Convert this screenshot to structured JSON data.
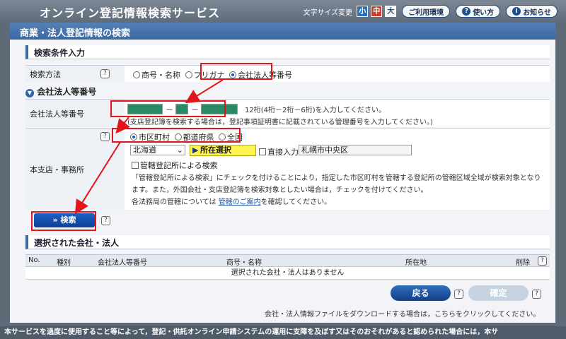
{
  "header": {
    "title": "オンライン登記情報検索サービス",
    "font_size_label": "文字サイズ変更",
    "font_sizes": [
      "小",
      "中",
      "大"
    ],
    "env": "ご利用環境",
    "howto": "使い方",
    "news": "お知らせ"
  },
  "page": {
    "title": "商業・法人登記情報の検索"
  },
  "conditions": {
    "title": "検索条件入力",
    "method_label": "検索方法",
    "methods": [
      "商号・名称",
      "フリガナ",
      "会社法人等番号"
    ],
    "number_section": "会社法人等番号",
    "number_label": "会社法人等番号",
    "number_hint": "12桁(4桁－2桁－6桁)を入力してください。",
    "number_hint2": "(支店登記簿を検索する場合は，登記事項証明書に記載されている管理番号を入力してください。)",
    "office_label": "本支店・事務所",
    "regions": [
      "市区町村",
      "都道府県",
      "全国"
    ],
    "prefecture": "北海道",
    "locate": "所在選択",
    "direct_label": "直接入力",
    "city": "札幌市中央区",
    "jurisdiction": "管轄登記所による検索",
    "desc1": "「管轄登記所による検索」にチェックを付けることにより，指定した市区町村を管轄する登記所の管轄区域全域が検索対象となり",
    "desc2": "ます。また，外国会社・支店登記簿を検索対象としたい場合は，チェックを付けてください。",
    "desc3": "各法務局の管轄については",
    "desc_link": "管轄のご案内",
    "desc4": "を確認してください。",
    "search": "検索"
  },
  "selected": {
    "title": "選択された会社・法人",
    "columns": [
      "No.",
      "種別",
      "会社法人等番号",
      "商号・名称",
      "所在地",
      "削除"
    ],
    "empty": "選択された会社・法人はありません"
  },
  "actions": {
    "back": "戻る",
    "confirm": "確定",
    "download_note": "会社・法人情報ファイルをダウンロードする場合は，こちらをクリックしてください。"
  },
  "footer": {
    "notice": "本サービスを過度に使用すること等によって，登記・供託オンライン申請システムの運用に支障を及ぼす又はそのおそれがあると認められた場合には，本サ"
  }
}
